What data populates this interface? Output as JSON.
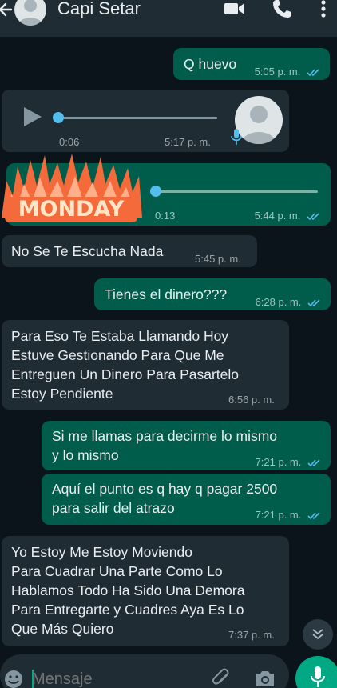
{
  "header": {
    "contact_name": "Capi Setar"
  },
  "messages": [
    {
      "kind": "text",
      "dir": "out",
      "text": "Q huevo",
      "time": "5:05 p. m.",
      "read": true
    },
    {
      "kind": "voice",
      "dir": "in",
      "duration": "0:06",
      "time": "5:17 p. m.",
      "progress": 0.0
    },
    {
      "kind": "voice",
      "dir": "out",
      "duration": "0:13",
      "time": "5:44 p. m.",
      "read": true,
      "progress": 0.0,
      "sticker": "MONDAY"
    },
    {
      "kind": "text",
      "dir": "in",
      "text": "No Se Te Escucha Nada",
      "time": "5:45 p. m."
    },
    {
      "kind": "text",
      "dir": "out",
      "text": "Tienes el dinero???",
      "time": "6:28 p. m.",
      "read": true
    },
    {
      "kind": "text",
      "dir": "in",
      "lines": [
        "Para Eso Te Estaba Llamando Hoy",
        "Estuve Gestionando Para Que Me",
        "Entreguen Un Dinero Para Pasartelo",
        "Estoy Pendiente"
      ],
      "time": "6:56 p. m."
    },
    {
      "kind": "text",
      "dir": "out",
      "lines": [
        "Si me llamas para decirme lo mismo",
        "y lo mismo"
      ],
      "time": "7:21 p. m.",
      "read": true
    },
    {
      "kind": "text",
      "dir": "out",
      "lines": [
        "Aquí el punto es q hay q pagar 2500",
        "para salir del atrazo"
      ],
      "time": "7:21 p. m.",
      "read": true
    },
    {
      "kind": "text",
      "dir": "in",
      "lines": [
        "Yo Estoy Me Estoy Moviendo",
        "Para Cuadrar Una Parte Como Lo",
        "Hablamos Todo Ha Sido Una Demora",
        "Para Entregarte y Cuadres Aya Es Lo",
        "Que Más Quiero"
      ],
      "time": "7:37 p. m."
    }
  ],
  "composer": {
    "placeholder": "Mensaje"
  },
  "icons": {
    "back": "arrow-back-icon",
    "video_call": "video-call-icon",
    "voice_call": "phone-icon",
    "menu": "more-vert-icon",
    "scroll_down": "double-chevron-down-icon",
    "emoji": "emoji-icon",
    "attach": "paperclip-icon",
    "camera": "camera-icon",
    "mic": "mic-icon"
  },
  "colors": {
    "background": "#0b141a",
    "header": "#1f2c34",
    "outgoing_bubble": "#005c4b",
    "incoming_bubble": "#1f2c34",
    "read_ticks": "#53bdeb",
    "accent": "#00a884"
  }
}
